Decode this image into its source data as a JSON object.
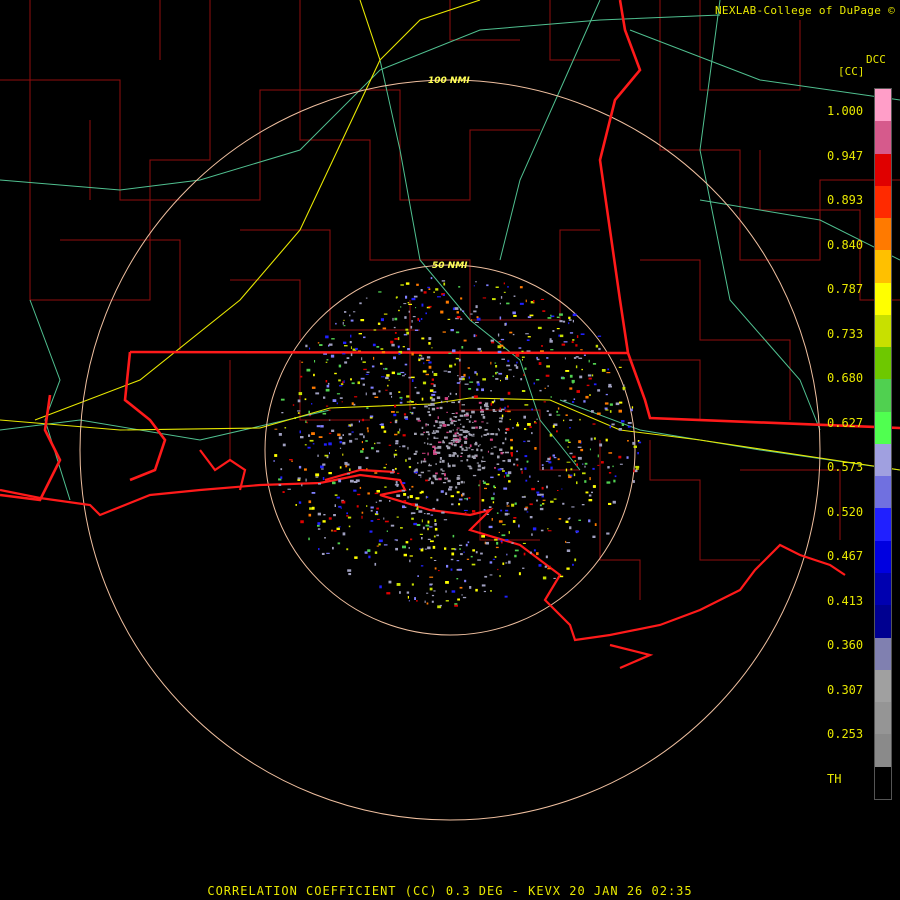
{
  "credit": "NEXLAB-College of DuPage ©",
  "scale": {
    "site": "DCC",
    "unit": "[CC]",
    "ticks": [
      "1.000",
      "0.947",
      "0.893",
      "0.840",
      "0.787",
      "0.733",
      "0.680",
      "0.627",
      "0.573",
      "0.520",
      "0.467",
      "0.413",
      "0.360",
      "0.307",
      "0.253",
      "TH"
    ],
    "colors": [
      "#ff9ec8",
      "#d65a8c",
      "#e00000",
      "#ff2a00",
      "#ff7a00",
      "#ffc000",
      "#ffff00",
      "#c8e000",
      "#6ec800",
      "#50d050",
      "#50ff50",
      "#a0a0e0",
      "#7070e0",
      "#2020ff",
      "#0000e0",
      "#0000b0",
      "#000090",
      "#8080b0",
      "#a0a0a0",
      "#959595",
      "#8a8a8a",
      "#000000"
    ]
  },
  "rings": {
    "inner": "50 NMI",
    "outer": "100 NMI"
  },
  "footer": "CORRELATION COEFFICIENT (CC) 0.3 DEG - KEVX 20 JAN 26 02:35"
}
